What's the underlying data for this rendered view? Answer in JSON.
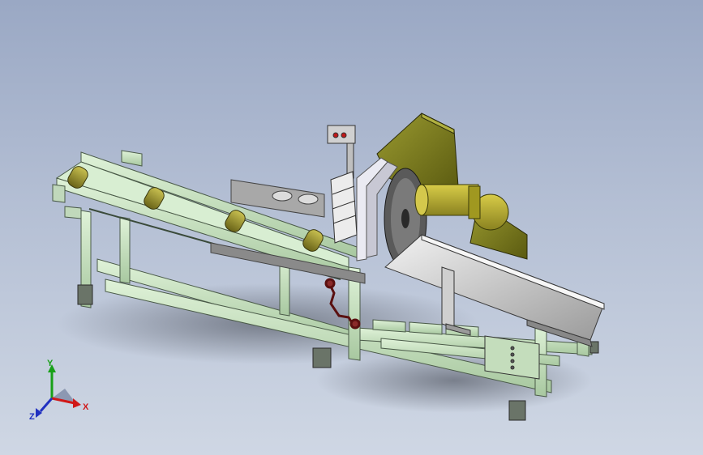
{
  "view": {
    "background_top": "#9aa8c4",
    "background_bottom": "#cfd7e4"
  },
  "model": {
    "frame_color": "#c8e6c0",
    "blade_guard_color": "#7a7a1e",
    "motor_color": "#b3a82a",
    "chute_color": "#d4d4d4",
    "handwheel_color": "#8a2a2a"
  },
  "triad": {
    "x_label": "X",
    "y_label": "Y",
    "z_label": "Z",
    "x_color": "#d01818",
    "y_color": "#18a018",
    "z_color": "#2030c0"
  }
}
